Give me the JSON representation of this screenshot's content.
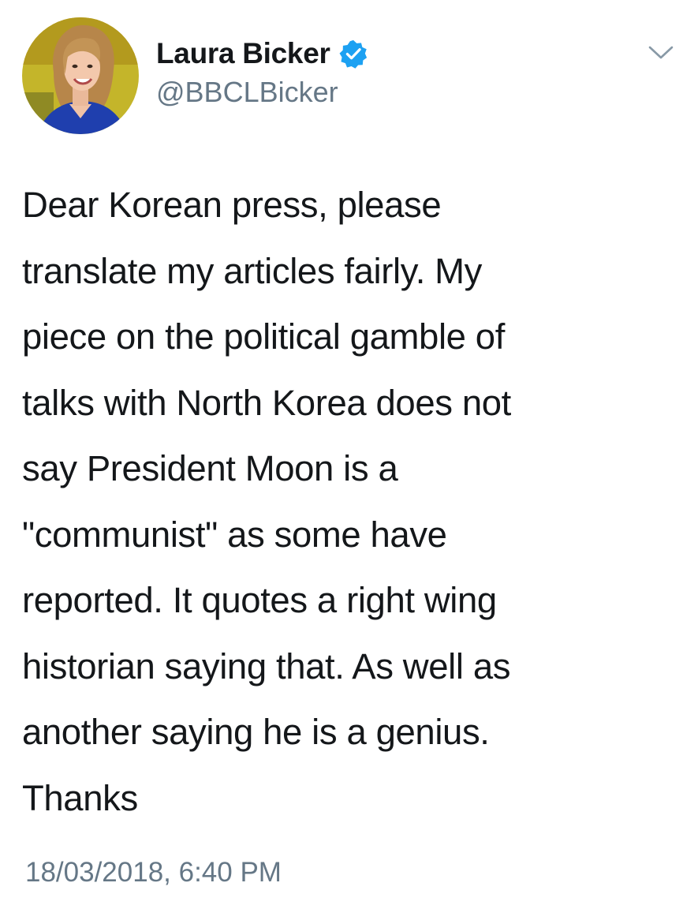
{
  "tweet": {
    "author": {
      "display_name": "Laura Bicker",
      "handle": "@BBCLBicker",
      "verified": true
    },
    "text_lines": [
      "Dear Korean press, please",
      "translate my articles fairly. My",
      "piece on the political gamble of",
      "talks with North Korea does not",
      "say President Moon is a",
      "\"communist\" as some have",
      "reported. It quotes a right wing",
      "historian saying that. As well as",
      "another saying he is a genius.",
      "Thanks"
    ],
    "timestamp": "18/03/2018, 6:40 PM"
  },
  "icons": {
    "verified": "verified-badge-icon",
    "menu": "chevron-down-icon"
  },
  "colors": {
    "text": "#14171a",
    "secondary": "#657786",
    "verified_blue": "#1da1f2",
    "avatar_background": "#c4b52a",
    "avatar_shirt": "#1f3fae"
  }
}
